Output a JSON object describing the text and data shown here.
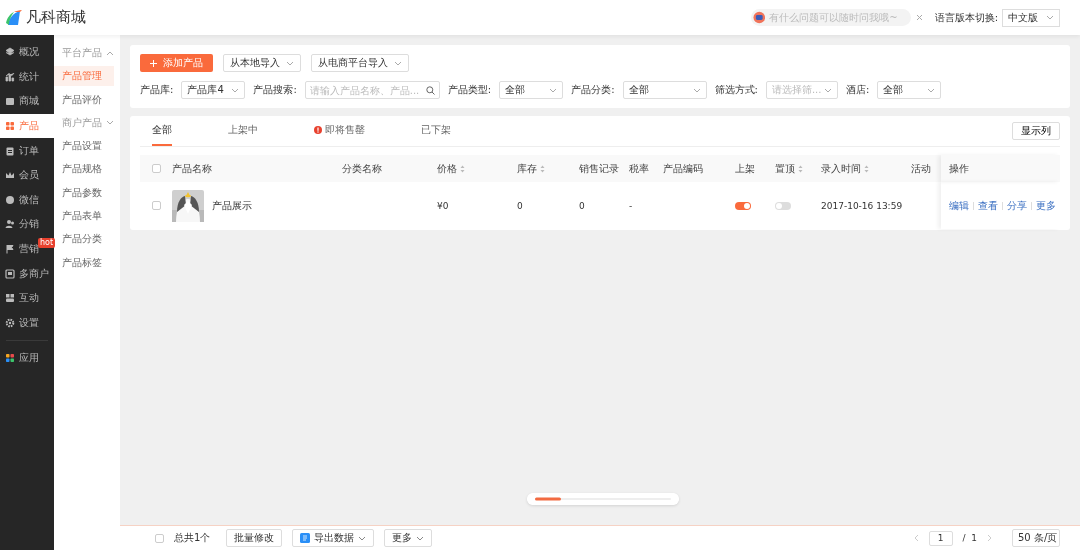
{
  "header": {
    "logo_text": "凡科商城",
    "assistant": {
      "placeholder": "有什么问题可以随时问我哦~"
    },
    "language": {
      "label": "语言版本切换:",
      "value": "中文版"
    }
  },
  "sidebar": {
    "items": [
      {
        "label": "概况",
        "selected": false
      },
      {
        "label": "统计",
        "selected": false
      },
      {
        "label": "商城",
        "selected": false
      },
      {
        "label": "产品",
        "selected": true
      },
      {
        "label": "订单",
        "selected": false
      },
      {
        "label": "会员",
        "selected": false
      },
      {
        "label": "微信",
        "selected": false
      },
      {
        "label": "分销",
        "selected": false
      },
      {
        "label": "营销",
        "selected": false,
        "badge": "hot"
      },
      {
        "label": "多商户",
        "selected": false
      },
      {
        "label": "互动",
        "selected": false
      },
      {
        "label": "设置",
        "selected": false
      },
      {
        "label": "应用",
        "selected": false
      }
    ]
  },
  "subnav": {
    "items": [
      {
        "kind": "group",
        "label": "平台产品",
        "expanded": true
      },
      {
        "kind": "item",
        "label": "产品管理",
        "selected": true
      },
      {
        "kind": "item",
        "label": "产品评价",
        "selected": false
      },
      {
        "kind": "group",
        "label": "商户产品",
        "expanded": false
      },
      {
        "kind": "item",
        "label": "产品设置",
        "selected": false
      },
      {
        "kind": "item",
        "label": "产品规格",
        "selected": false
      },
      {
        "kind": "item",
        "label": "产品参数",
        "selected": false
      },
      {
        "kind": "item",
        "label": "产品表单",
        "selected": false
      },
      {
        "kind": "item",
        "label": "产品分类",
        "selected": false
      },
      {
        "kind": "item",
        "label": "产品标签",
        "selected": false
      }
    ]
  },
  "toolbar": {
    "add_button": "添加产品",
    "import_buttons": [
      "从本地导入",
      "从电商平台导入"
    ]
  },
  "filters": [
    {
      "kind": "select",
      "label": "产品库:",
      "value": "产品库4"
    },
    {
      "kind": "search",
      "label": "产品搜索:",
      "placeholder": "请输入产品名称、产品..."
    },
    {
      "kind": "select",
      "label": "产品类型:",
      "value": "全部"
    },
    {
      "kind": "select",
      "label": "产品分类:",
      "value": "全部"
    },
    {
      "kind": "select",
      "label": "筛选方式:",
      "placeholder": "请选择筛..."
    },
    {
      "kind": "select",
      "label": "酒店:",
      "value": "全部"
    }
  ],
  "tabs": [
    {
      "label": "全部",
      "selected": true,
      "alert": false
    },
    {
      "label": "上架中",
      "selected": false,
      "alert": false
    },
    {
      "label": "即将售罄",
      "selected": false,
      "alert": true
    },
    {
      "label": "已下架",
      "selected": false,
      "alert": false
    }
  ],
  "columns_button": "显示列",
  "table": {
    "select_all_checked": false,
    "columns": [
      {
        "label": "产品名称",
        "sortable": false
      },
      {
        "label": "分类名称",
        "sortable": false
      },
      {
        "label": "价格",
        "sortable": true
      },
      {
        "label": "库存",
        "sortable": true
      },
      {
        "label": "销售记录",
        "sortable": false
      },
      {
        "label": "税率",
        "sortable": false
      },
      {
        "label": "产品编码",
        "sortable": false
      },
      {
        "label": "上架",
        "sortable": false
      },
      {
        "label": "置顶",
        "sortable": true
      },
      {
        "label": "录入时间",
        "sortable": true
      },
      {
        "label": "活动",
        "sortable": false
      },
      {
        "label": "操作",
        "sortable": false
      }
    ],
    "rows": [
      {
        "checked": false,
        "name": "产品展示",
        "price": "¥0",
        "stock": "0",
        "sales": "0",
        "tax": "-",
        "listed": true,
        "pinned": false,
        "created": "2017-10-16 13:59",
        "actions": [
          "编辑",
          "查看",
          "分享",
          "更多"
        ]
      }
    ]
  },
  "bottom_bar": {
    "select_all_checked": false,
    "total": "总共1个",
    "buttons": [
      {
        "kind": "plain",
        "label": "批量修改"
      },
      {
        "kind": "export",
        "label": "导出数据"
      },
      {
        "kind": "dropdown",
        "label": "更多"
      }
    ],
    "pagination": {
      "page": "1",
      "separator": "/",
      "total_pages": "1",
      "page_size": "50 条/页"
    }
  }
}
